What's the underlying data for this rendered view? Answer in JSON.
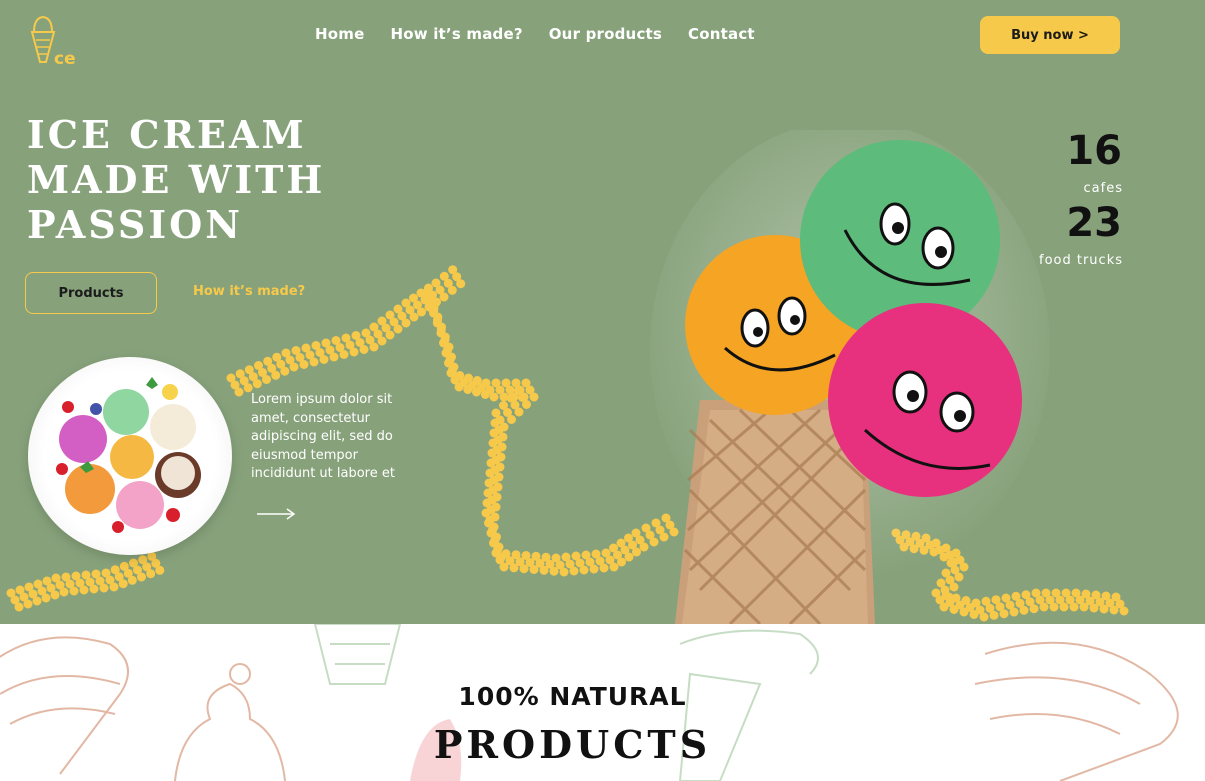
{
  "nav": {
    "items": [
      {
        "label": "Home"
      },
      {
        "label": "How it’s made?"
      },
      {
        "label": "Our products"
      },
      {
        "label": "Contact"
      }
    ],
    "buy_label": "Buy now >"
  },
  "logo": {
    "icon": "ice-cream-cone-icon",
    "text": "ce"
  },
  "hero": {
    "title_lines": [
      "ICE CREAM",
      "MADE WITH",
      "PASSION"
    ],
    "products_button": "Products",
    "how_link": "How it’s made?",
    "description": "Lorem ipsum dolor sit amet, consectetur adipiscing elit, sed do eiusmod tempor incididunt ut labore et"
  },
  "stats": [
    {
      "value": "16",
      "label": "cafes"
    },
    {
      "value": "23",
      "label": "food trucks"
    }
  ],
  "products_section": {
    "subtitle": "100% NATURAL",
    "title": "PRODUCTS"
  },
  "colors": {
    "hero_bg": "#87a27b",
    "accent": "#f7c94b",
    "dark": "#111111",
    "white": "#ffffff"
  }
}
